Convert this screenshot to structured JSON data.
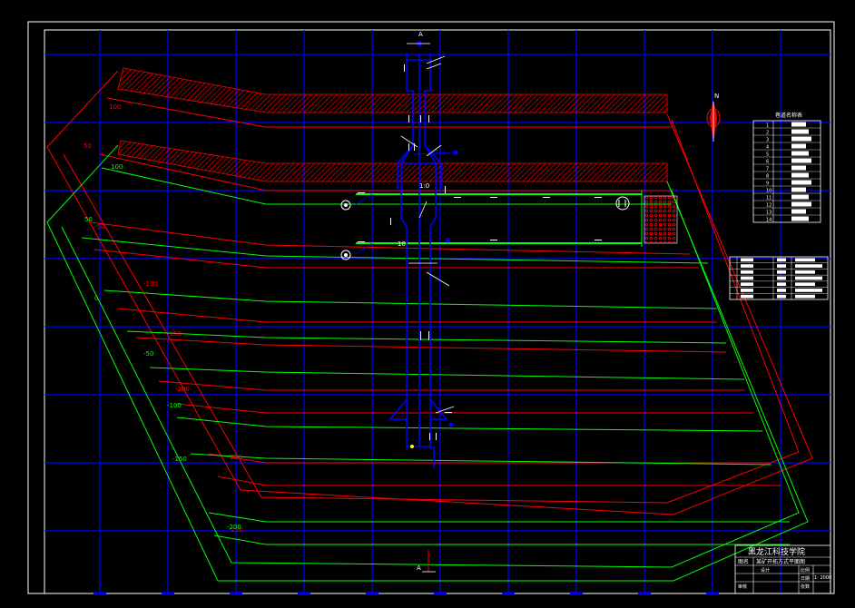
{
  "section_marks": {
    "top": "A",
    "bottom": "A"
  },
  "north": {
    "label": "N"
  },
  "contours_red": [
    "100",
    "50",
    "-50",
    "-100",
    "-150",
    "-200",
    "-250",
    "-250"
  ],
  "contours_green": [
    "100",
    "50",
    "0",
    "-50",
    "-100",
    "-150",
    "-200"
  ],
  "shaft_labels": {
    "upper": "1:0",
    "lower": "10"
  },
  "legend_table": {
    "title": "巷道名称表",
    "rows": [
      "1",
      "2",
      "3",
      "4",
      "5",
      "6",
      "7",
      "8",
      "9",
      "10",
      "11",
      "12",
      "13",
      "14"
    ]
  },
  "title_block": {
    "school": "黑龙江科技学院",
    "drawing_name_label": "图名",
    "drawing_name": "某矿开拓方式平面图",
    "designer_label": "设计",
    "scale_label": "比例",
    "scale": "1: 2000",
    "checker_label": "审核",
    "date_label": "日期",
    "sheet_label": "张数"
  },
  "colors": {
    "background": "#000000",
    "frame": "#ffffff",
    "grid": "#0000ff",
    "contour_red": "#ff0000",
    "contour_green": "#00ff00",
    "roadway": "#0000ff",
    "hatch": "#ff0000"
  }
}
